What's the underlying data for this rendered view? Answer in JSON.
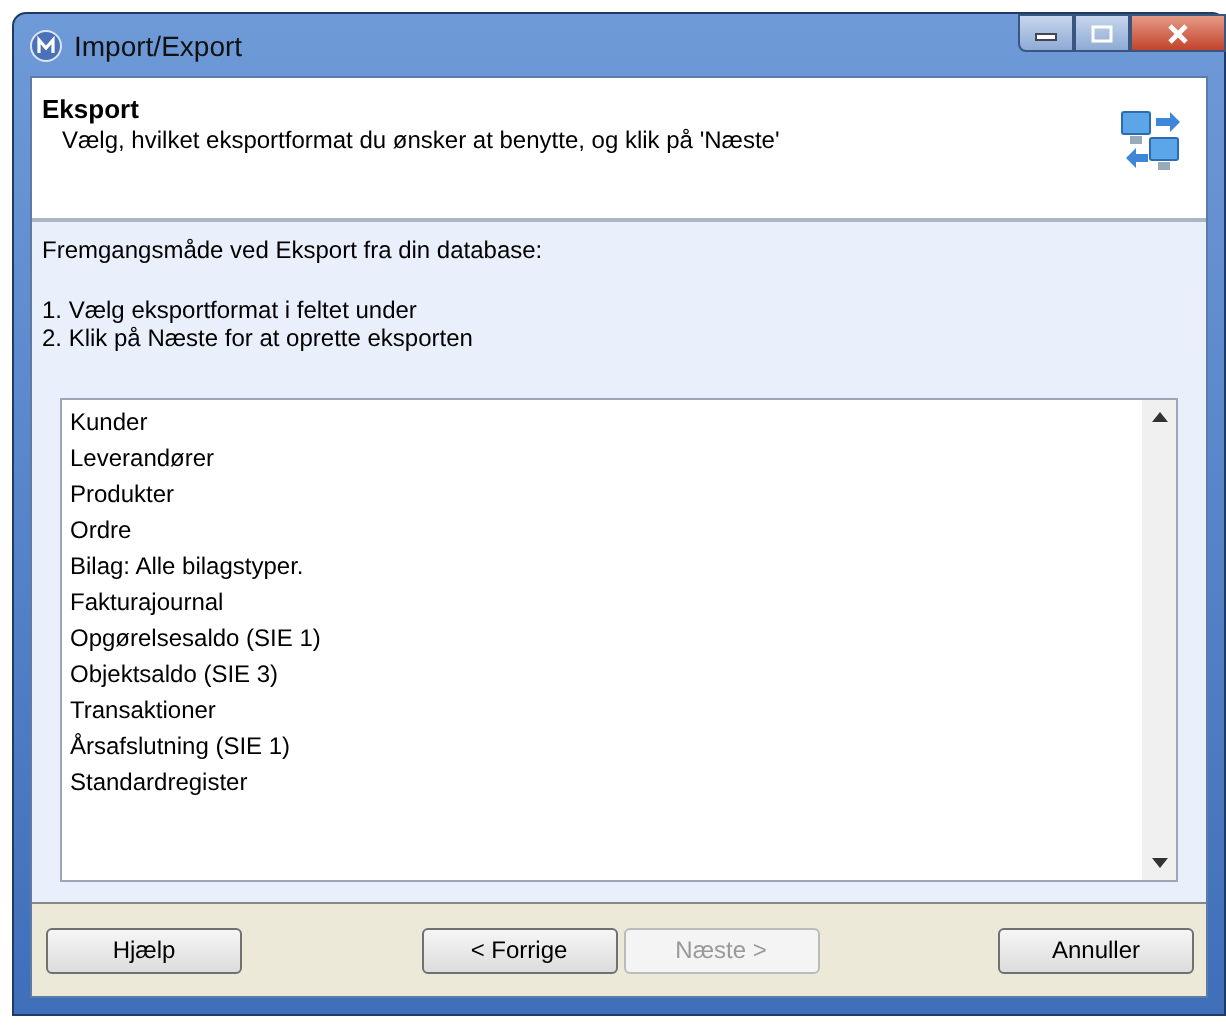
{
  "window": {
    "title": "Import/Export"
  },
  "header": {
    "title": "Eksport",
    "subtitle": "Vælg, hvilket eksportformat du ønsker at benytte, og klik på 'Næste'"
  },
  "instructions": {
    "intro": "Fremgangsmåde ved Eksport fra din database:",
    "steps": [
      "1.  Vælg eksportformat i feltet under",
      "2.  Klik på Næste for at oprette eksporten"
    ]
  },
  "list": {
    "items": [
      {
        "label": "Kunder",
        "selected": false
      },
      {
        "label": "Leverandører",
        "selected": false
      },
      {
        "label": "Produkter",
        "selected": false
      },
      {
        "label": "Ordre",
        "selected": false
      },
      {
        "label": "Bilag: Alle bilagstyper.",
        "selected": false
      },
      {
        "label": "Fakturajournal",
        "selected": false
      },
      {
        "label": "Opgørelsesaldo (SIE 1)",
        "selected": false
      },
      {
        "label": "Objektsaldo (SIE 3)",
        "selected": false
      },
      {
        "label": "Transaktioner",
        "selected": false
      },
      {
        "label": "Årsafslutning (SIE 1)",
        "selected": false
      },
      {
        "label": "Standardregister",
        "selected": false
      }
    ]
  },
  "buttons": [
    {
      "label": "Hjælp",
      "disabled": false,
      "kind": "left"
    },
    {
      "label": "< Forrige",
      "disabled": false,
      "kind": "nav"
    },
    {
      "label": "Næste >",
      "disabled": true,
      "kind": "nav"
    },
    {
      "label": "Annuller",
      "disabled": false,
      "kind": "right"
    }
  ]
}
